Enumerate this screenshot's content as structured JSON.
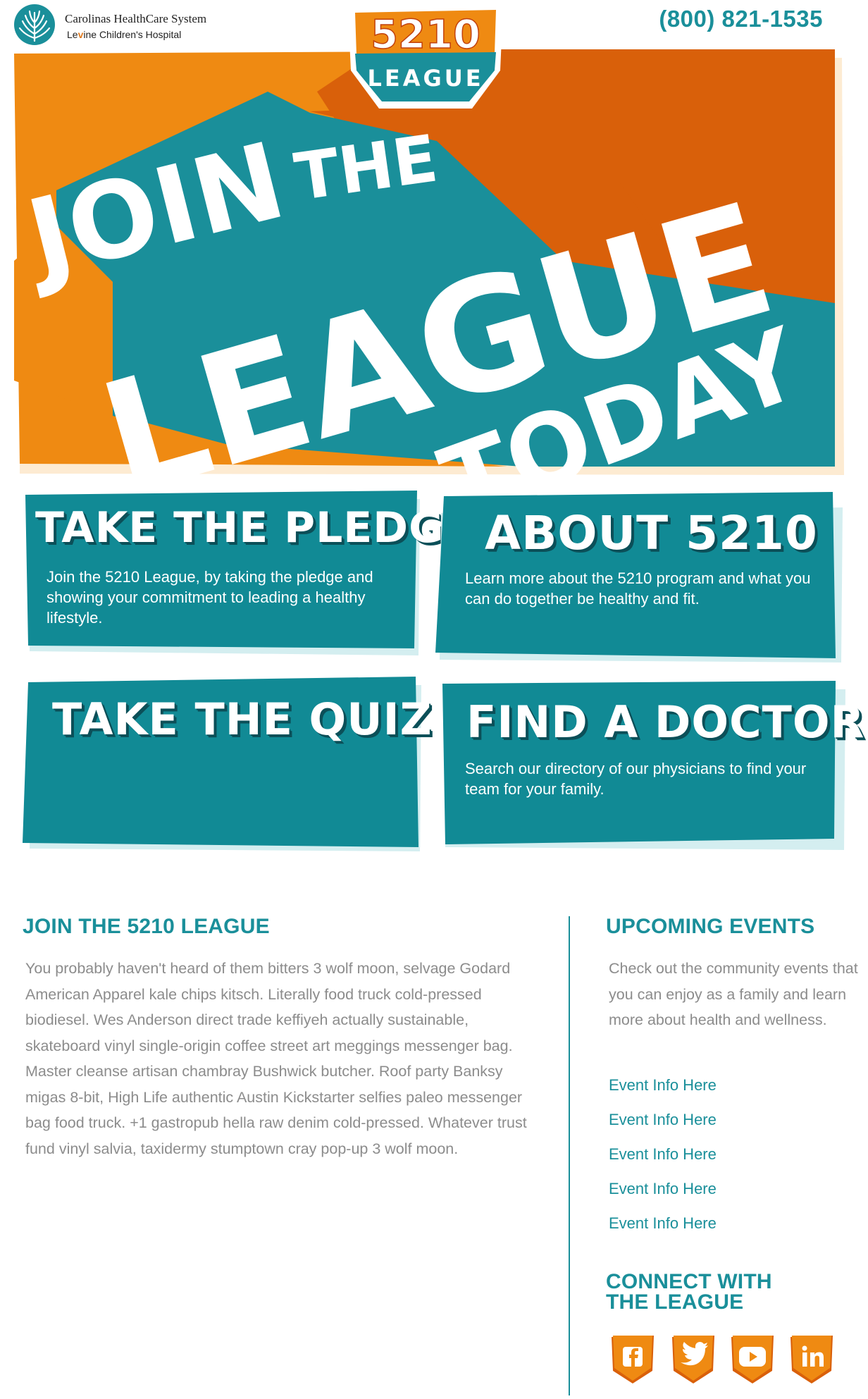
{
  "header": {
    "org_name": "Carolinas HealthCare System",
    "hospital_name_prefix": "Le",
    "hospital_name_accent": "v",
    "hospital_name_suffix": "ine Children's Hospital",
    "phone": "(800) 821-1535"
  },
  "badge": {
    "number": "5210",
    "word": "LEAGUE"
  },
  "hero": {
    "line1_a": "JOIN",
    "line1_b": "THE",
    "line2": "LEAGUE",
    "line3": "TODAY"
  },
  "cards": [
    {
      "title": "TAKE THE PLEDGE",
      "desc": "Join the 5210 League, by taking the pledge and showing your commitment to leading a healthy lifestyle."
    },
    {
      "title": "ABOUT 5210",
      "desc": "Learn more about the 5210 program and what you can do together be healthy and fit."
    },
    {
      "title": "TAKE THE QUIZ",
      "desc": ""
    },
    {
      "title": "FIND A DOCTOR",
      "desc": "Search our directory of our physicians to find your team for your family."
    }
  ],
  "join": {
    "title": "JOIN THE 5210 LEAGUE",
    "body": "You probably haven't heard of them bitters 3 wolf moon, selvage Godard American Apparel kale chips kitsch. Literally food truck cold-pressed biodiesel. Wes Anderson direct trade keffiyeh actually sustainable, skateboard vinyl single-origin coffee street art meggings messenger bag. Master cleanse artisan chambray Bushwick butcher. Roof party Banksy migas 8-bit, High Life authentic Austin Kickstarter selfies paleo messenger bag food truck. +1 gastropub hella raw denim cold-pressed. Whatever trust fund vinyl salvia, taxidermy stumptown cray pop-up 3 wolf moon."
  },
  "events": {
    "title": "UPCOMING EVENTS",
    "intro": "Check out the community events that you can enjoy as a family and learn more about health and wellness.",
    "items": [
      "Event Info Here",
      "Event Info Here",
      "Event Info Here",
      "Event Info Here",
      "Event Info Here"
    ]
  },
  "connect": {
    "title_line1": "CONNECT WITH",
    "title_line2": "THE LEAGUE",
    "icons": [
      "facebook-icon",
      "twitter-icon",
      "youtube-icon",
      "linkedin-icon"
    ]
  },
  "colors": {
    "teal": "#1a8f9a",
    "dark_teal": "#0b4f58",
    "orange": "#ef8a12",
    "dark_orange": "#d9600a"
  }
}
